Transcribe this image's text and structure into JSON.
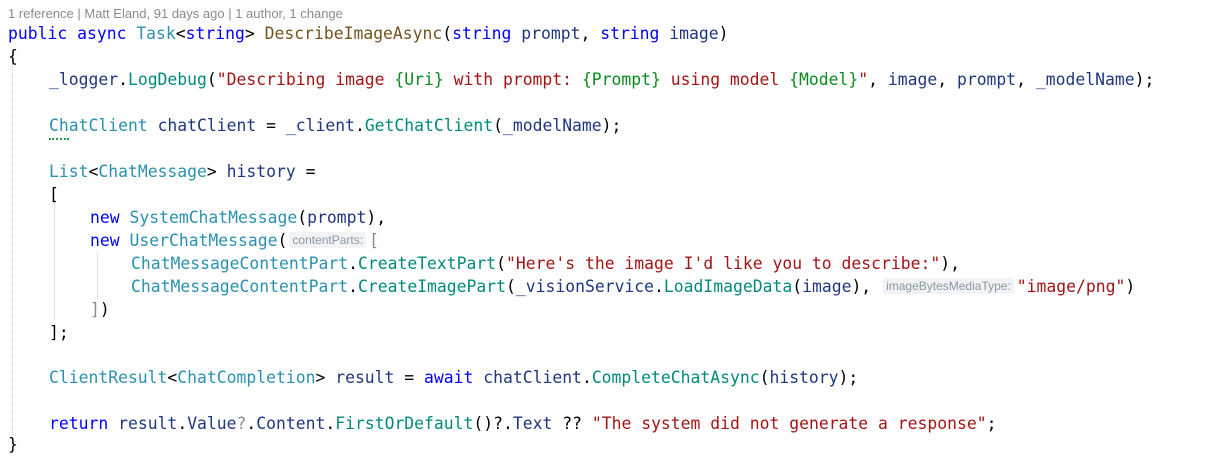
{
  "codelens": {
    "references": "1 reference",
    "sep1": " | ",
    "author_time": "Matt Eland, 91 days ago",
    "sep2": " | ",
    "changes": "1 author, 1 change"
  },
  "code": {
    "l1": {
      "kw1": "public",
      "sp1": " ",
      "kw2": "async",
      "sp2": " ",
      "type": "Task",
      "lt": "<",
      "kw3": "string",
      "gt": ">",
      "sp3": " ",
      "method": "DescribeImageAsync",
      "p1": "(",
      "kw4": "string",
      "sp4": " ",
      "param1": "prompt",
      "c1": ", ",
      "kw5": "string",
      "sp5": " ",
      "param2": "image",
      "p2": ")"
    },
    "l2": {
      "brace": "{"
    },
    "l3": {
      "field": "_logger",
      "dot": ".",
      "method": "LogDebug",
      "p1": "(",
      "s1": "\"Describing image ",
      "ph1": "{Uri}",
      "s2": " with prompt: ",
      "ph2": "{Prompt}",
      "s3": " using model ",
      "ph3": "{Model}",
      "s4": "\"",
      "c1": ", ",
      "a1": "image",
      "c2": ", ",
      "a2": "prompt",
      "c3": ", ",
      "a3": "_modelName",
      "end": ");"
    },
    "l4": {
      "type": "ChatClient",
      "sp1": " ",
      "var": "chatClient",
      "eq": " = ",
      "field": "_client",
      "dot": ".",
      "method": "GetChatClient",
      "p1": "(",
      "arg": "_modelName",
      "end": ");"
    },
    "l5": {
      "type": "List",
      "lt": "<",
      "type2": "ChatMessage",
      "gt": ">",
      "sp1": " ",
      "var": "history",
      "eq": " ="
    },
    "l6": {
      "bracket": "["
    },
    "l7": {
      "kw": "new",
      "sp1": " ",
      "type": "SystemChatMessage",
      "p1": "(",
      "arg": "prompt",
      "end": "),"
    },
    "l8": {
      "kw": "new",
      "sp1": " ",
      "type": "UserChatMessage",
      "p1": "(",
      "hint": "contentParts:",
      "bracket": "["
    },
    "l9": {
      "type": "ChatMessageContentPart",
      "dot": ".",
      "method": "CreateTextPart",
      "p1": "(",
      "str": "\"Here's the image I'd like you to describe:\"",
      "end": "),"
    },
    "l10": {
      "type": "ChatMessageContentPart",
      "dot": ".",
      "method": "CreateImagePart",
      "p1": "(",
      "field": "_visionService",
      "dot2": ".",
      "method2": "LoadImageData",
      "p2": "(",
      "arg": "image",
      "p3": "),",
      "sp": " ",
      "hint": "imageBytesMediaType:",
      "str": "\"image/png\"",
      "end": ")"
    },
    "l11": {
      "bracket": "]",
      "end": ")"
    },
    "l12": {
      "bracket": "]",
      "end": ";"
    },
    "l13": {
      "type": "ClientResult",
      "lt": "<",
      "type2": "ChatCompletion",
      "gt": ">",
      "sp1": " ",
      "var": "result",
      "eq": " = ",
      "kw": "await",
      "sp2": " ",
      "var2": "chatClient",
      "dot": ".",
      "method": "CompleteChatAsync",
      "p1": "(",
      "arg": "history",
      "end": ");"
    },
    "l14": {
      "kw": "return",
      "sp1": " ",
      "var": "result",
      "dot": ".",
      "prop1": "Value",
      "q1": "?",
      "dot2": ".",
      "prop2": "Content",
      "dot3": ".",
      "method": "FirstOrDefault",
      "p1": "()",
      "q2": "?",
      "dot4": ".",
      "prop3": "Text",
      "op": " ?? ",
      "str": "\"The system did not generate a response\"",
      "end": ";"
    },
    "l15": {
      "brace": "}"
    }
  }
}
